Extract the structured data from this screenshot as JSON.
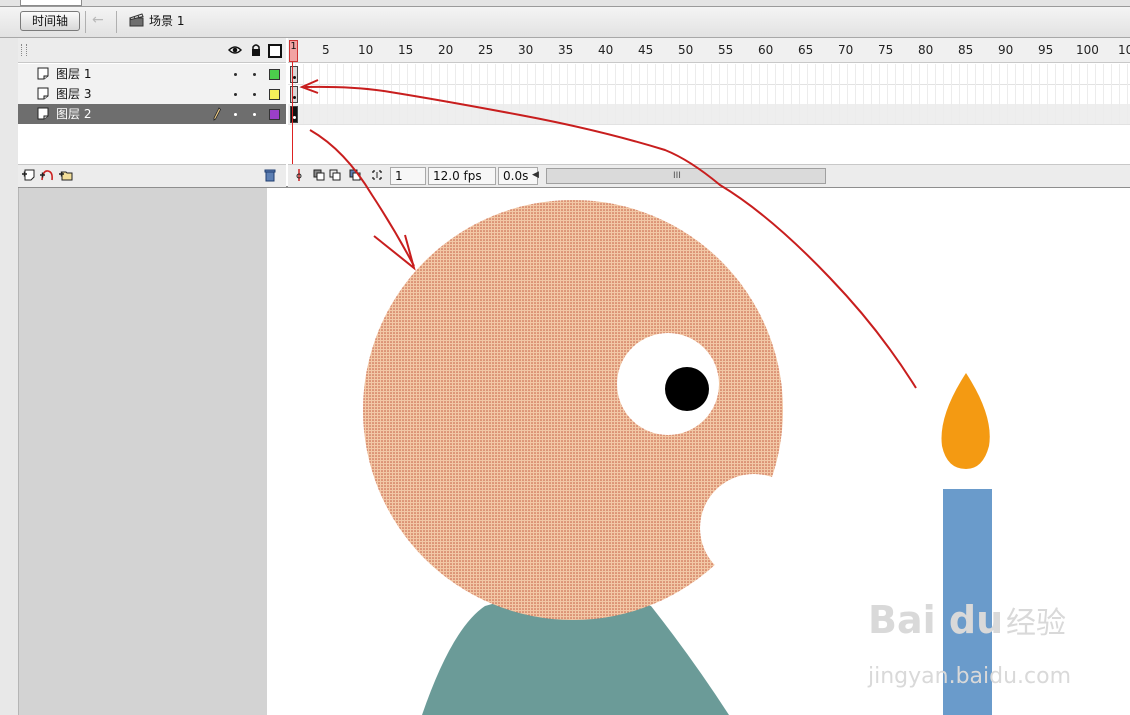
{
  "toolbar": {
    "timeline_button": "时间轴",
    "back_icon": "back-arrow-icon",
    "scene_icon": "clapperboard-icon",
    "scene_label": "场景 1"
  },
  "timeline": {
    "header_icons": [
      "eye-icon",
      "lock-icon",
      "outline-icon"
    ],
    "layers": [
      {
        "name": "图层 1",
        "color": "#4ccf4c",
        "selected": false
      },
      {
        "name": "图层 3",
        "color": "#f5f05a",
        "selected": false
      },
      {
        "name": "图层 2",
        "color": "#9b3fc7",
        "selected": true
      }
    ],
    "ruler": {
      "playhead_label": "1",
      "ticks": [
        "5",
        "10",
        "15",
        "20",
        "25",
        "30",
        "35",
        "40",
        "45",
        "50",
        "55",
        "60",
        "65",
        "70",
        "75",
        "80",
        "85",
        "90",
        "95",
        "100",
        "10"
      ]
    },
    "footer": {
      "current_frame": "1",
      "frame_rate": "12.0 fps",
      "elapsed": "0.0s",
      "scroll_grip": "III"
    }
  },
  "stage": {
    "colors": {
      "head": "#f2c8a6",
      "head_dots": "#c0533a",
      "body": "#6b9b98",
      "candle": "#6a9bcb",
      "flame": "#f49a12",
      "annotation": "#c81e1e"
    }
  },
  "watermark": {
    "logo": "Bai du",
    "chinese": "经验",
    "url": "jingyan.baidu.com"
  }
}
